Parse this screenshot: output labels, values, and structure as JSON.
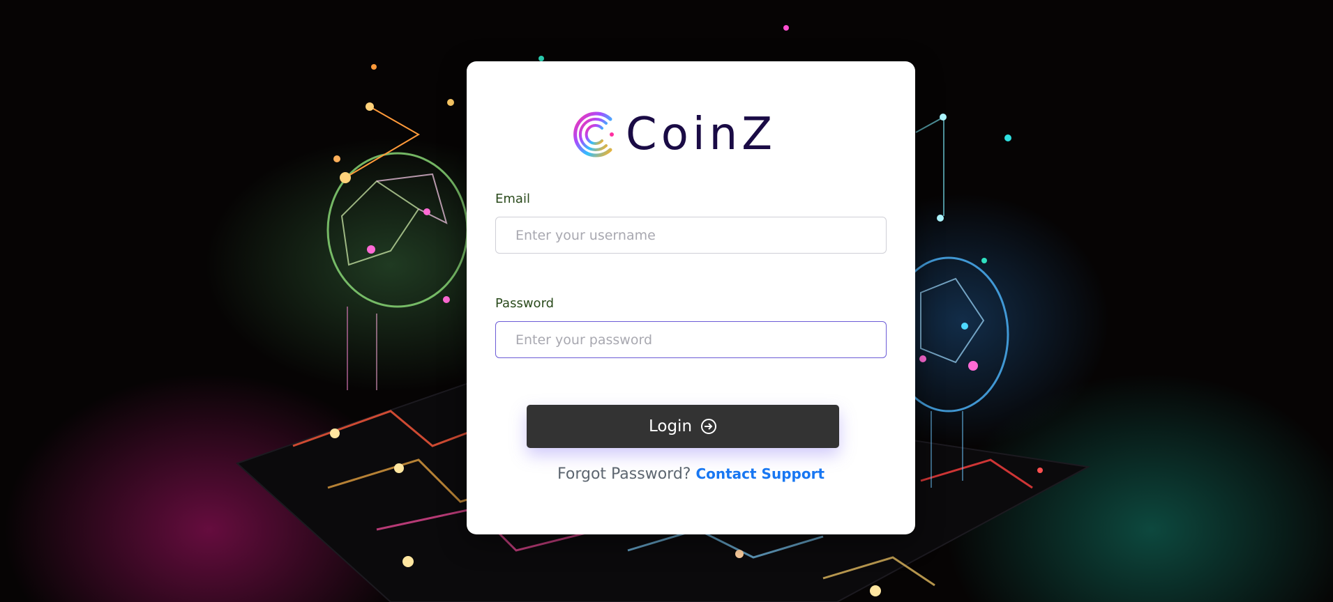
{
  "brand": {
    "name": "CoinZ"
  },
  "form": {
    "email_label": "Email",
    "email_placeholder": "Enter your username",
    "password_label": "Password",
    "password_placeholder": "Enter your password",
    "login_label": "Login",
    "forgot_text": "Forgot Password?",
    "support_link": "Contact Support"
  },
  "colors": {
    "button_bg": "#333333",
    "link": "#1877f2",
    "label": "#2a4a1c",
    "brand_text": "#1a0b45",
    "focus_border": "#6b5bd6"
  },
  "icons": {
    "login": "login-arrow-circle-icon",
    "logo": "coinz-logo-icon"
  }
}
